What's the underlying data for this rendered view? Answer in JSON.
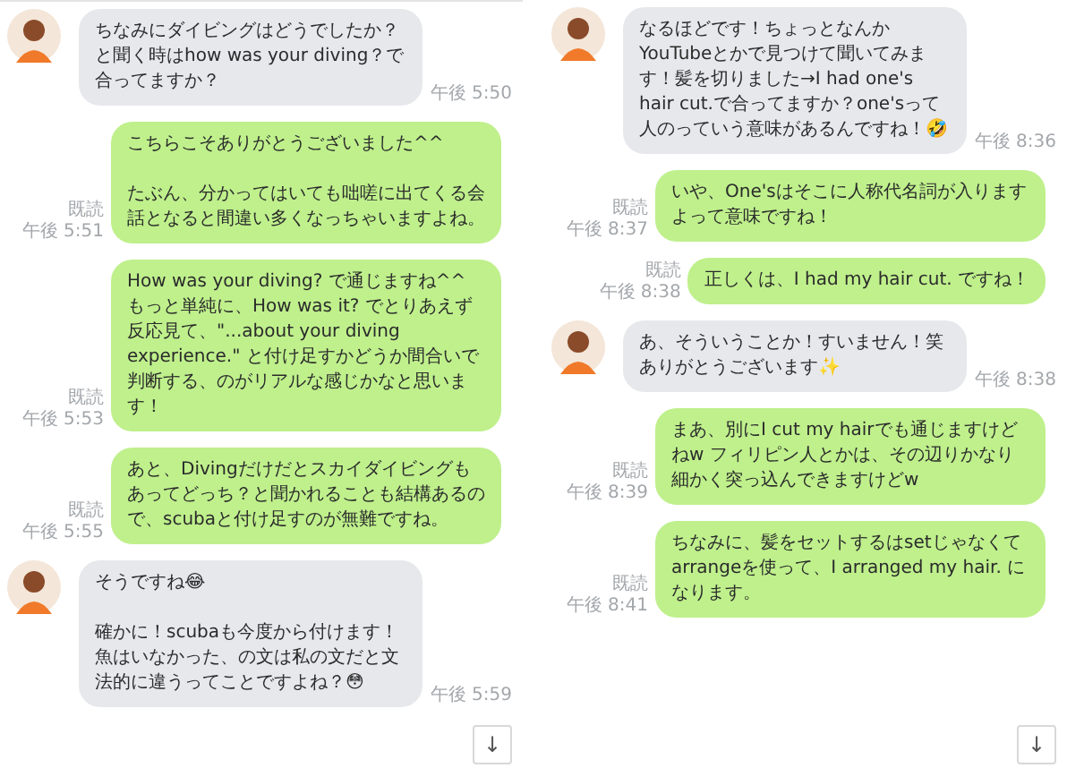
{
  "panels": [
    {
      "messages": [
        {
          "kind": "incoming",
          "paragraphs": [
            "ちなみにダイビングはどうでしたか？と聞く時はhow was your diving？で合ってますか？"
          ],
          "time": "午後 5:50"
        },
        {
          "kind": "outgoing",
          "paragraphs": [
            "こちらこそありがとうございました^^",
            "たぶん、分かってはいても咄嗟に出てくる会話となると間違い多くなっちゃいますよね。"
          ],
          "read": "既読",
          "time": "午後 5:51"
        },
        {
          "kind": "outgoing",
          "paragraphs": [
            "How was your diving? で通じますね^^\nもっと単純に、How was it? でとりあえず反応見て、\"...about your diving experience.\" と付け足すかどうか間合いで判断する、のがリアルな感じかなと思います！"
          ],
          "read": "既読",
          "time": "午後 5:53"
        },
        {
          "kind": "outgoing",
          "paragraphs": [
            "あと、Divingだけだとスカイダイビングもあってどっち？と聞かれることも結構あるので、scubaと付け足すのが無難ですね。"
          ],
          "read": "既読",
          "time": "午後 5:55"
        },
        {
          "kind": "incoming",
          "paragraphs": [
            "そうですね😂",
            "確かに！scubaも今度から付けます！魚はいなかった、の文は私の文だと文法的に違うってことですよね？😳"
          ],
          "time": "午後 5:59"
        }
      ],
      "scroll_button": "↓"
    },
    {
      "messages": [
        {
          "kind": "incoming",
          "paragraphs": [
            "なるほどです！ちょっとなんかYouTubeとかで見つけて聞いてみます！髪を切りました→I had one's hair cut.で合ってますか？one'sって人のっていう意味があるんですね！🤣"
          ],
          "time": "午後 8:36"
        },
        {
          "kind": "outgoing",
          "paragraphs": [
            "いや、One'sはそこに人称代名詞が入りますよって意味ですね！"
          ],
          "read": "既読",
          "time": "午後 8:37"
        },
        {
          "kind": "outgoing",
          "paragraphs": [
            "正しくは、I had my hair cut. ですね！"
          ],
          "read": "既読",
          "time": "午後 8:38"
        },
        {
          "kind": "incoming",
          "paragraphs": [
            "あ、そういうことか！すいません！笑ありがとうございます✨"
          ],
          "time": "午後 8:38"
        },
        {
          "kind": "outgoing",
          "paragraphs": [
            "まあ、別にI cut my hairでも通じますけどねw フィリピン人とかは、その辺りかなり細かく突っ込んできますけどw"
          ],
          "read": "既読",
          "time": "午後 8:39"
        },
        {
          "kind": "outgoing",
          "paragraphs": [
            "ちなみに、髪をセットするはsetじゃなくてarrangeを使って、I arranged my hair. になります。"
          ],
          "read": "既読",
          "time": "午後 8:41"
        }
      ],
      "scroll_button": "↓"
    }
  ]
}
